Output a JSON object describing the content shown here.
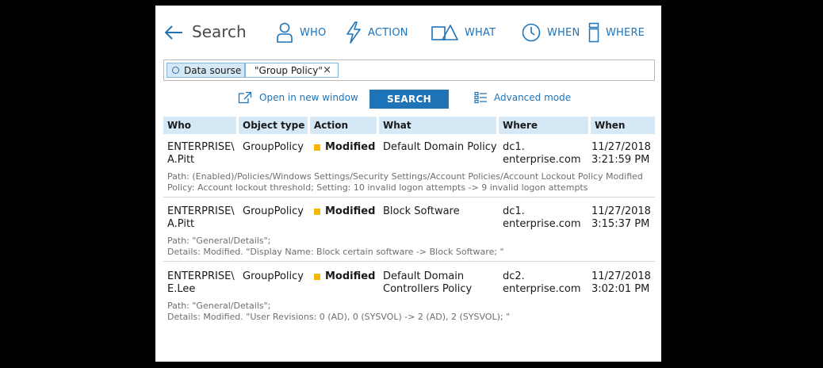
{
  "header": {
    "back_icon": "arrow-left-icon",
    "title": "Search",
    "nav": [
      {
        "label": "WHO",
        "icon": "person-icon"
      },
      {
        "label": "ACTION",
        "icon": "lightning-icon"
      },
      {
        "label": "WHAT",
        "icon": "shapes-icon"
      },
      {
        "label": "WHEN",
        "icon": "clock-icon"
      },
      {
        "label": "WHERE",
        "icon": "server-icon"
      }
    ]
  },
  "filter": {
    "source_label": "Data sourse",
    "source_value": "\"Group Policy\"",
    "remove": "×"
  },
  "actions": {
    "open_new_window": "Open in new window",
    "search": "SEARCH",
    "advanced_mode": "Advanced mode"
  },
  "table": {
    "columns": [
      "Who",
      "Object type",
      "Action",
      "What",
      "Where",
      "When"
    ],
    "rows": [
      {
        "who": [
          "ENTERPRISE\\",
          "A.Pitt"
        ],
        "object_type": "GroupPolicy",
        "action": "Modified",
        "what": [
          "Default Domain Policy"
        ],
        "where": [
          "dc1.",
          "enterprise.com"
        ],
        "when": [
          "11/27/2018",
          "3:21:59 PM"
        ],
        "details": [
          "Path: (Enabled)/Policies/Windows Settings/Security Settings/Account Policies/Account Lockout Policy Modified",
          "Policy: Account lockout threshold; Setting: 10 invalid logon attempts -> 9 invalid logon attempts"
        ]
      },
      {
        "who": [
          "ENTERPRISE\\",
          "A.Pitt"
        ],
        "object_type": "GroupPolicy",
        "action": "Modified",
        "what": [
          "Block Software"
        ],
        "where": [
          "dc1.",
          "enterprise.com"
        ],
        "when": [
          "11/27/2018",
          "3:15:37 PM"
        ],
        "details": [
          "Path: \"General/Details\";",
          "Details: Modified. \"Display Name: Block certain software -> Block Software; \""
        ]
      },
      {
        "who": [
          "ENTERPRISE\\",
          "E.Lee"
        ],
        "object_type": "GroupPolicy",
        "action": "Modified",
        "what": [
          "Default Domain",
          "Controllers Policy"
        ],
        "where": [
          "dc2.",
          "enterprise.com"
        ],
        "when": [
          "11/27/2018",
          "3:02:01 PM"
        ],
        "details": [
          "Path: \"General/Details\";",
          "Details: Modified. \"User Revisions: 0 (AD), 0 (SYSVOL) -> 2 (AD), 2 (SYSVOL); \""
        ]
      }
    ]
  },
  "colors": {
    "accent": "#1f73b7",
    "header_bg": "#d5e8f6",
    "modified_marker": "#f5b800"
  }
}
